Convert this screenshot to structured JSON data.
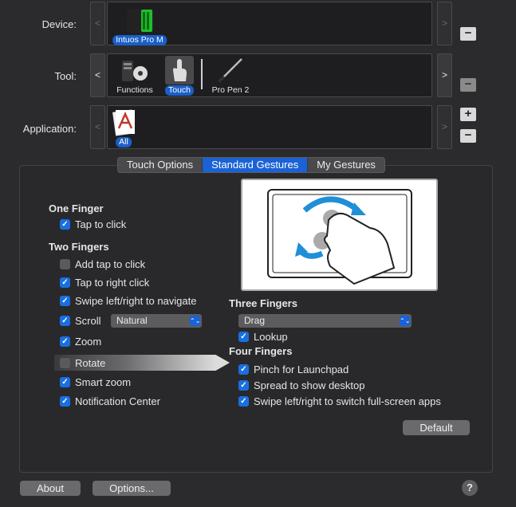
{
  "device": {
    "label": "Device:",
    "item": "Intuos Pro M"
  },
  "tool": {
    "label": "Tool:",
    "items": [
      "Functions",
      "Touch",
      "Pro Pen 2"
    ],
    "selected": "Touch"
  },
  "application": {
    "label": "Application:",
    "item": "All"
  },
  "nav": {
    "left": "<",
    "right": ">",
    "plus": "+",
    "minus": "−"
  },
  "tabs": [
    "Touch Options",
    "Standard Gestures",
    "My Gestures"
  ],
  "one_finger": {
    "title": "One Finger",
    "options": [
      {
        "label": "Tap to click",
        "checked": true
      }
    ]
  },
  "two_fingers": {
    "title": "Two Fingers",
    "options": [
      {
        "label": "Add tap to click",
        "checked": false
      },
      {
        "label": "Tap to right click",
        "checked": true
      },
      {
        "label": "Swipe left/right to navigate",
        "checked": true
      },
      {
        "label": "Scroll",
        "checked": true
      },
      {
        "label": "Zoom",
        "checked": true
      },
      {
        "label": "Rotate",
        "checked": false
      },
      {
        "label": "Smart zoom",
        "checked": true
      },
      {
        "label": "Notification Center",
        "checked": true
      }
    ],
    "scroll_select": "Natural"
  },
  "three_fingers": {
    "title": "Three Fingers",
    "select": "Drag",
    "options": [
      {
        "label": "Lookup",
        "checked": true
      }
    ]
  },
  "four_fingers": {
    "title": "Four Fingers",
    "options": [
      {
        "label": "Pinch for Launchpad",
        "checked": true
      },
      {
        "label": "Spread to show desktop",
        "checked": true
      },
      {
        "label": "Swipe left/right to switch full-screen apps",
        "checked": true
      }
    ]
  },
  "buttons": {
    "default": "Default",
    "about": "About",
    "options": "Options...",
    "help": "?"
  },
  "checkmark": "✓",
  "chevron": "⌃⌄",
  "colors": {
    "accent": "#1a62d6",
    "background": "#2b2b2d",
    "gesture_arrow": "#1f8fd8"
  }
}
